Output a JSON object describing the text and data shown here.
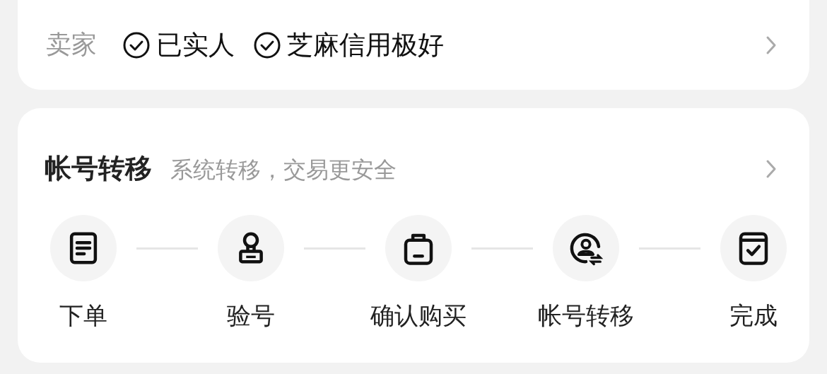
{
  "seller": {
    "label": "卖家",
    "badges": [
      "已实人",
      "芝麻信用极好"
    ]
  },
  "transfer": {
    "title": "帐号转移",
    "subtitle": "系统转移，交易更安全",
    "steps": [
      {
        "label": "下单"
      },
      {
        "label": "验号"
      },
      {
        "label": "确认购买"
      },
      {
        "label": "帐号转移"
      },
      {
        "label": "完成"
      }
    ]
  }
}
